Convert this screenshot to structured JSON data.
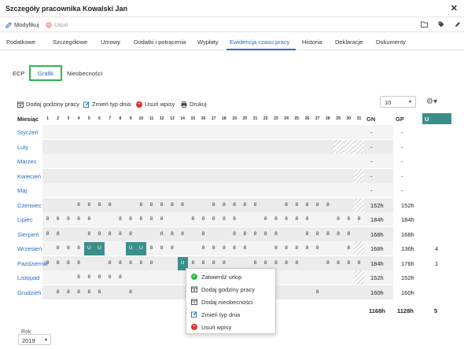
{
  "window": {
    "title": "Szczegóły pracownika Kowalski Jan",
    "close_glyph": "✕"
  },
  "actions": {
    "modify_label": "Modyfikuj",
    "delete_label": "Usuń"
  },
  "tabs": [
    {
      "label": "Podatkowe"
    },
    {
      "label": "Szczegółowe"
    },
    {
      "label": "Umowy"
    },
    {
      "label": "Dodatki i potrącenia"
    },
    {
      "label": "Wypłaty"
    },
    {
      "label": "Ewidencja czasu pracy",
      "active": true
    },
    {
      "label": "Historia"
    },
    {
      "label": "Deklaracje"
    },
    {
      "label": "Dokumenty"
    }
  ],
  "subtabs": [
    {
      "label": "ECP"
    },
    {
      "label": "Grafik",
      "active": true
    },
    {
      "label": "Nieobecności"
    }
  ],
  "toolbar": {
    "add_hours": "Dodaj godziny pracy",
    "change_day": "Zmień typ dnia",
    "remove": "Usuń wpisy",
    "print": "Drukuj",
    "page_size": "10"
  },
  "grid": {
    "month_header": "Miesiąc",
    "days": [
      "1",
      "2",
      "3",
      "4",
      "5",
      "6",
      "7",
      "8",
      "9",
      "10",
      "11",
      "12",
      "13",
      "14",
      "15",
      "16",
      "17",
      "18",
      "19",
      "20",
      "21",
      "22",
      "23",
      "24",
      "25",
      "26",
      "27",
      "28",
      "29",
      "30",
      "31"
    ],
    "gn_header": "GN",
    "gp_header": "GP",
    "u_header": "U",
    "months": [
      {
        "name": "Styczeń",
        "gn": "-",
        "gp": "-",
        "u": ""
      },
      {
        "name": "Luty",
        "gn": "-",
        "gp": "-",
        "u": ""
      },
      {
        "name": "Marzec",
        "gn": "-",
        "gp": "-",
        "u": ""
      },
      {
        "name": "Kwiecień",
        "gn": "-",
        "gp": "-",
        "u": ""
      },
      {
        "name": "Maj",
        "gn": "-",
        "gp": "-",
        "u": ""
      },
      {
        "name": "Czerwiec",
        "gn": "152h",
        "gp": "152h",
        "u": ""
      },
      {
        "name": "Lipiec",
        "gn": "184h",
        "gp": "184h",
        "u": ""
      },
      {
        "name": "Sierpień",
        "gn": "168h",
        "gp": "168h",
        "u": ""
      },
      {
        "name": "Wrzesień",
        "gn": "168h",
        "gp": "136h",
        "u": "4"
      },
      {
        "name": "Październik",
        "gn": "184h",
        "gp": "176h",
        "u": "1"
      },
      {
        "name": "Listopad",
        "gn": "152h",
        "gp": "152h",
        "u": ""
      },
      {
        "name": "Grudzień",
        "gn": "160h",
        "gp": "160h",
        "u": ""
      }
    ],
    "cells": [
      [],
      [],
      [],
      [],
      [],
      [
        [
          4,
          "8"
        ],
        [
          5,
          "8"
        ],
        [
          6,
          "8"
        ],
        [
          7,
          "8"
        ],
        [
          10,
          "8"
        ],
        [
          11,
          "8"
        ],
        [
          12,
          "8"
        ],
        [
          13,
          "8"
        ],
        [
          14,
          "8"
        ],
        [
          17,
          "8"
        ],
        [
          18,
          "8"
        ],
        [
          19,
          "8"
        ],
        [
          20,
          "8"
        ],
        [
          21,
          "8"
        ],
        [
          24,
          "8"
        ],
        [
          25,
          "8"
        ],
        [
          26,
          "8"
        ],
        [
          27,
          "8"
        ],
        [
          28,
          "8"
        ]
      ],
      [
        [
          1,
          "8"
        ],
        [
          2,
          "8"
        ],
        [
          3,
          "8"
        ],
        [
          4,
          "8"
        ],
        [
          5,
          "8"
        ],
        [
          8,
          "8"
        ],
        [
          9,
          "8"
        ],
        [
          10,
          "8"
        ],
        [
          11,
          "8"
        ],
        [
          12,
          "8"
        ],
        [
          15,
          "8"
        ],
        [
          16,
          "8"
        ],
        [
          17,
          "8"
        ],
        [
          18,
          "8"
        ],
        [
          19,
          "8"
        ],
        [
          22,
          "8"
        ],
        [
          23,
          "8"
        ],
        [
          24,
          "8"
        ],
        [
          25,
          "8"
        ],
        [
          26,
          "8"
        ],
        [
          29,
          "8"
        ],
        [
          30,
          "8"
        ],
        [
          31,
          "8"
        ]
      ],
      [
        [
          1,
          "8"
        ],
        [
          2,
          "8"
        ],
        [
          5,
          "8"
        ],
        [
          6,
          "8"
        ],
        [
          7,
          "8"
        ],
        [
          8,
          "8"
        ],
        [
          9,
          "8"
        ],
        [
          12,
          "8"
        ],
        [
          13,
          "8"
        ],
        [
          14,
          "8"
        ],
        [
          16,
          "8"
        ],
        [
          19,
          "8"
        ],
        [
          20,
          "8"
        ],
        [
          21,
          "8"
        ],
        [
          22,
          "8"
        ],
        [
          23,
          "8"
        ],
        [
          26,
          "8"
        ],
        [
          27,
          "8"
        ],
        [
          28,
          "8"
        ],
        [
          29,
          "8"
        ],
        [
          30,
          "8"
        ]
      ],
      [
        [
          2,
          "8"
        ],
        [
          3,
          "8"
        ],
        [
          4,
          "8"
        ],
        [
          5,
          "U"
        ],
        [
          6,
          "U"
        ],
        [
          9,
          "U"
        ],
        [
          10,
          "U"
        ],
        [
          11,
          "8"
        ],
        [
          12,
          "8"
        ],
        [
          13,
          "8"
        ],
        [
          16,
          "8"
        ],
        [
          17,
          "8"
        ],
        [
          18,
          "8"
        ],
        [
          19,
          "8"
        ],
        [
          20,
          "8"
        ],
        [
          23,
          "8"
        ],
        [
          24,
          "8"
        ],
        [
          25,
          "8"
        ],
        [
          26,
          "8"
        ],
        [
          27,
          "8"
        ],
        [
          30,
          "8"
        ]
      ],
      [
        [
          1,
          "8"
        ],
        [
          2,
          "8"
        ],
        [
          3,
          "8"
        ],
        [
          4,
          "8"
        ],
        [
          7,
          "8"
        ],
        [
          8,
          "8"
        ],
        [
          9,
          "8"
        ],
        [
          10,
          "8"
        ],
        [
          11,
          "8"
        ],
        [
          14,
          "U"
        ],
        [
          15,
          "8"
        ],
        [
          16,
          "8"
        ],
        [
          17,
          "8"
        ],
        [
          18,
          "8"
        ],
        [
          21,
          "8"
        ],
        [
          22,
          "8"
        ],
        [
          23,
          "8"
        ],
        [
          24,
          "8"
        ],
        [
          25,
          "8"
        ],
        [
          28,
          "8"
        ],
        [
          29,
          "8"
        ],
        [
          30,
          "8"
        ],
        [
          31,
          "8"
        ]
      ],
      [
        [
          4,
          "8"
        ],
        [
          5,
          "8"
        ],
        [
          6,
          "8"
        ],
        [
          7,
          "8"
        ],
        [
          8,
          "8"
        ]
      ],
      [
        [
          2,
          "8"
        ],
        [
          3,
          "8"
        ],
        [
          4,
          "8"
        ],
        [
          5,
          "8"
        ],
        [
          6,
          "8"
        ],
        [
          9,
          "8"
        ],
        [
          27,
          "8"
        ]
      ]
    ],
    "totals": {
      "gn": "1168h",
      "gp": "1128h",
      "u": "5"
    }
  },
  "year": {
    "label": "Rok",
    "value": "2019"
  },
  "context_menu": [
    {
      "label": "Zatwierdź urlop",
      "icon": "check-circle-icon"
    },
    {
      "label": "Dodaj godziny pracy",
      "icon": "calendar-add-icon"
    },
    {
      "label": "Dodaj nieobecności",
      "icon": "calendar-absence-icon"
    },
    {
      "label": "Zmień typ dnia",
      "icon": "edit-icon"
    },
    {
      "label": "Usuń wpisy",
      "icon": "remove-circle-icon"
    }
  ],
  "colors": {
    "accent": "#2b6cc4",
    "vacation": "#3a8f8b",
    "highlight_box": "#2db84d",
    "delete": "#d9342b"
  }
}
